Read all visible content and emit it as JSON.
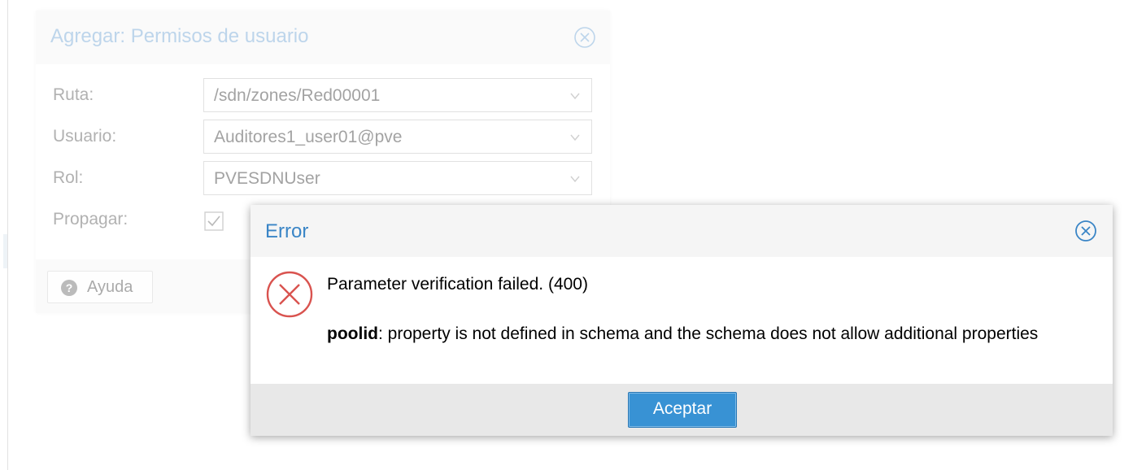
{
  "background_dialog": {
    "title": "Agregar: Permisos de usuario",
    "fields": [
      {
        "label": "Ruta:",
        "value": "/sdn/zones/Red00001"
      },
      {
        "label": "Usuario:",
        "value": "Auditores1_user01@pve"
      },
      {
        "label": "Rol:",
        "value": "PVESDNUser"
      }
    ],
    "propagate": {
      "label": "Propagar:",
      "checked": true
    },
    "help_button": {
      "label": "Ayuda"
    }
  },
  "error_dialog": {
    "title": "Error",
    "message": "Parameter verification failed. (400)",
    "detail": {
      "field": "poolid",
      "text": ": property is not defined in schema and the schema does not allow additional properties"
    },
    "ok_button": "Aceptar"
  },
  "colors": {
    "title_blue": "#3a85c6",
    "error_red": "#d9534f",
    "button_blue": "#3892d4"
  },
  "icons": {
    "close": "close-circle-icon",
    "error": "error-circle-x-icon",
    "dropdown": "chevron-down-icon",
    "help": "question-circle-icon",
    "checkbox": "checkbox-checked-icon"
  }
}
